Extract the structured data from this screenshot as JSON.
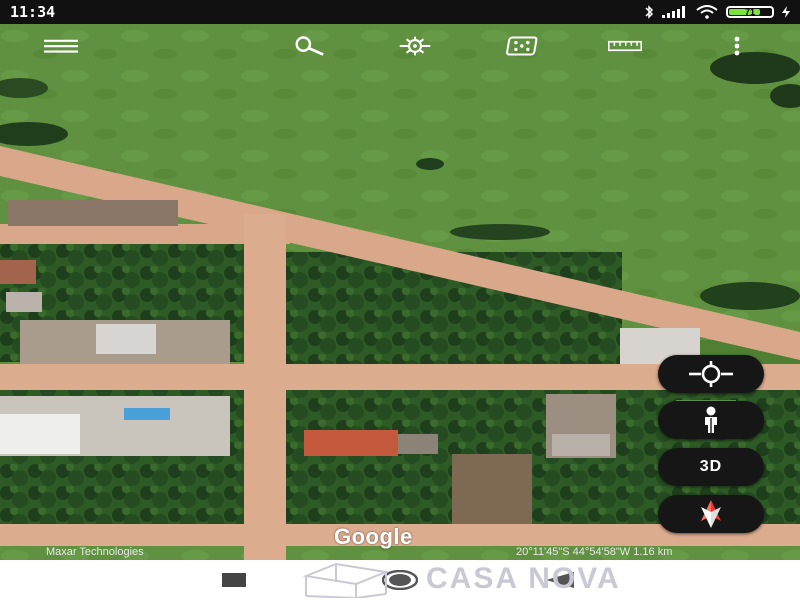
{
  "status": {
    "time": "11:34",
    "battery_level": "71",
    "icons": [
      "bluetooth-icon",
      "signal-icon",
      "wifi-icon",
      "battery-icon",
      "charging-icon"
    ]
  },
  "toolbar": {
    "items": [
      "menu-icon",
      "search-icon",
      "voyager-icon",
      "dice-icon",
      "ruler-icon",
      "more-options-icon"
    ]
  },
  "map_controls": {
    "location_icon": "my-location-icon",
    "pegman_icon": "street-view-icon",
    "three_d_label": "3D",
    "compass_icon": "compass-icon"
  },
  "map_overlay": {
    "logo": "Google",
    "attribution": "Maxar Technologies",
    "coordinates": "20°11'45\"S 44°54'58\"W 1.16 km"
  },
  "navbar": {
    "items": [
      "recent-apps-icon",
      "home-icon",
      "back-icon"
    ]
  },
  "watermark": {
    "text": "CASA NOVA"
  },
  "colors": {
    "field_green": "#5c8d3a",
    "dirt_road": "#d9a88a",
    "tree_dark": "#22451f",
    "control_bg": "#161616",
    "battery_green": "#7ce33a"
  }
}
